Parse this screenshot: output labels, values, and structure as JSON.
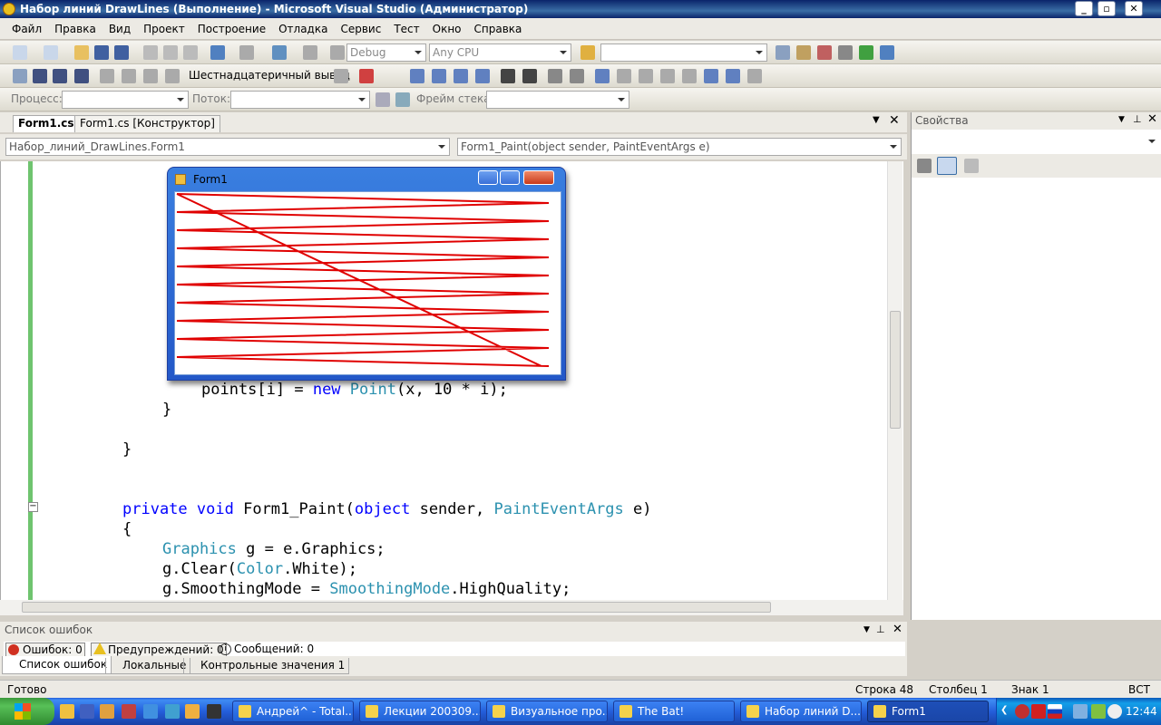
{
  "window": {
    "title": "Набор линий DrawLines (Выполнение) - Microsoft Visual Studio (Администратор)"
  },
  "menu": [
    "Файл",
    "Правка",
    "Вид",
    "Проект",
    "Построение",
    "Отладка",
    "Сервис",
    "Тест",
    "Окно",
    "Справка"
  ],
  "toolbar1": {
    "config": "Debug",
    "platform": "Any CPU"
  },
  "toolbar2": {
    "hex_label": "Шестнадцатеричный вывод"
  },
  "toolbar3": {
    "process_label": "Процесс:",
    "thread_label": "Поток:",
    "stack_label": "Фрейм стека:"
  },
  "tabs": [
    "Form1.cs",
    "Form1.cs [Конструктор]"
  ],
  "nav": {
    "class": "Набор_линий_DrawLines.Form1",
    "method": "Form1_Paint(object sender, PaintEventArgs e)"
  },
  "code": {
    "l1a": "points[i] = ",
    "l1b": "new",
    "l1c": " ",
    "l1d": "Point",
    "l1e": "(x, 10 * i);",
    "l2": "}",
    "l3": "}",
    "l4a": "private",
    "l4b": " ",
    "l4c": "void",
    "l4d": " Form1_Paint(",
    "l4e": "object",
    "l4f": " sender, ",
    "l4g": "PaintEventArgs",
    "l4h": " e)",
    "l5": "{",
    "l6a": "Graphics",
    "l6b": " g = e.Graphics;",
    "l7a": "g.Clear(",
    "l7b": "Color",
    "l7c": ".White);",
    "l8a": "g.SmoothingMode = ",
    "l8b": "SmoothingMode",
    "l8c": ".HighQuality;"
  },
  "form1": {
    "title": "Form1",
    "line_color": "#e00000"
  },
  "properties": {
    "title": "Свойства"
  },
  "errors": {
    "title": "Список ошибок",
    "errors": "Ошибок: 0",
    "warnings": "Предупреждений: 0",
    "messages": "Сообщений: 0"
  },
  "bottom_tabs": [
    "Список ошибок",
    "Локальные",
    "Контрольные значения 1"
  ],
  "status": {
    "ready": "Готово",
    "line": "Строка 48",
    "col": "Столбец 1",
    "ch": "Знак 1",
    "ins": "ВСТ"
  },
  "taskbar": {
    "items": [
      "Андрей^ - Total...",
      "Лекции 200309....",
      "Визуальное про...",
      "The Bat!",
      "Набор линий D...",
      "Form1"
    ],
    "time": "12:44"
  }
}
